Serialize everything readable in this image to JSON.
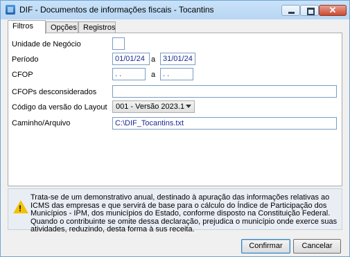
{
  "window": {
    "title": "DIF - Documentos de informações fiscais - Tocantins"
  },
  "tabs": [
    {
      "label": "Filtros",
      "active": true
    },
    {
      "label": "Opções",
      "active": false
    },
    {
      "label": "Registros",
      "active": false
    }
  ],
  "form": {
    "unidade_label": "Unidade de Negócio",
    "unidade_value": "",
    "periodo_label": "Período",
    "periodo_start": "01/01/24",
    "periodo_sep": "a",
    "periodo_end": "31/01/24",
    "cfop_label": "CFOP",
    "cfop_start": " . .",
    "cfop_sep": "a",
    "cfop_end": " . .",
    "cfops_desc_label": "CFOPs desconsiderados",
    "cfops_desc_value": "",
    "layout_label": "Código da versão do Layout",
    "layout_value": "001 - Versão 2023.1",
    "caminho_label": "Caminho/Arquivo",
    "caminho_value": "C:\\DIF_Tocantins.txt"
  },
  "info": {
    "icon": "warning-icon",
    "text": "Trata-se de um demonstrativo anual, destinado à apuração das informações relativas ao ICMS das empresas e que servirá de base para o cálculo do Índice de Participação dos Municípios - IPM, dos municípios do Estado, conforme disposto na Constituição Federal. Quando o contribuinte se omite dessa declaração, prejudica o município onde exerce suas atividades, reduzindo,  desta forma à sus receita."
  },
  "buttons": {
    "confirm": "Confirmar",
    "cancel": "Cancelar"
  },
  "colors": {
    "field_text": "#1a2a8f",
    "title_bar": "#b7d6f3",
    "close_button": "#c94a30",
    "warning": "#f2c200"
  }
}
